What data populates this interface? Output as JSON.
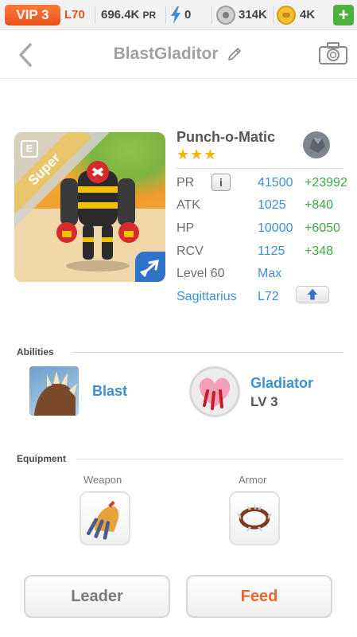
{
  "topbar": {
    "vip": "VIP 3",
    "level": "L70",
    "power": "696.4K",
    "power_unit": "PR",
    "energy": "0",
    "paws": "314K",
    "gold": "4K",
    "add": "+"
  },
  "header": {
    "title": "BlastGladitor"
  },
  "monster": {
    "rarity_ribbon": "Super",
    "name": "Punch-o-Matic",
    "stars": "★★★",
    "stars_count": 3,
    "stats": [
      {
        "label": "PR",
        "value": "41500",
        "bonus": "+23992"
      },
      {
        "label": "ATK",
        "value": "1025",
        "bonus": "+840"
      },
      {
        "label": "HP",
        "value": "10000",
        "bonus": "+6050"
      },
      {
        "label": "RCV",
        "value": "1125",
        "bonus": "+348"
      }
    ],
    "info_button": "i",
    "level_label": "Level 60",
    "level_value": "Max",
    "constellation": "Sagittarius",
    "constellation_level": "L72"
  },
  "abilities": {
    "title": "Abilities",
    "items": [
      {
        "name": "Blast"
      },
      {
        "name": "Gladiator",
        "level": "LV 3"
      }
    ]
  },
  "equipment": {
    "title": "Equipment",
    "weapon_label": "Weapon",
    "armor_label": "Armor"
  },
  "buttons": {
    "leader": "Leader",
    "feed": "Feed"
  },
  "colors": {
    "accent_orange": "#e8521a",
    "link_blue": "#3d8fd6",
    "bonus_green": "#3da944"
  }
}
